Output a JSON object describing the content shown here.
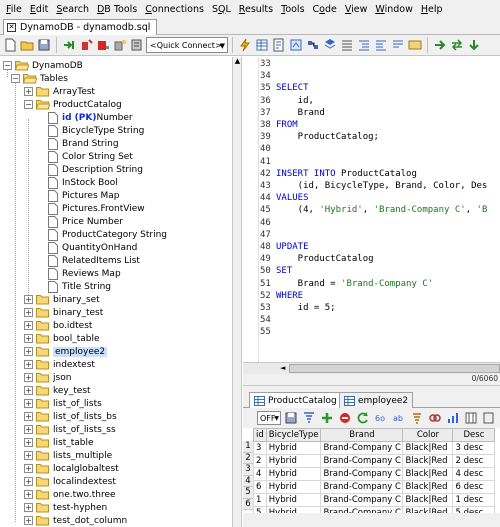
{
  "menu": [
    "File",
    "Edit",
    "Search",
    "DB Tools",
    "Connections",
    "SQL",
    "Results",
    "Tools",
    "Code",
    "View",
    "Window",
    "Help"
  ],
  "menu_mnemonic": [
    "F",
    "E",
    "S",
    "D",
    "C",
    "Q",
    "R",
    "T",
    "o",
    "V",
    "W",
    "H"
  ],
  "file_tab": {
    "title": "DynamoDB - dynamodb.sql"
  },
  "toolbar": {
    "quick_connect": "<Quick Connect>"
  },
  "tree": {
    "root": "DynamoDB",
    "tables_label": "Tables",
    "tables": [
      "ArrayTest",
      "ProductCatalog"
    ],
    "columns": [
      {
        "pk": "id (PK)",
        "rest": " Number"
      },
      {
        "pk": "",
        "rest": "BicycleType String"
      },
      {
        "pk": "",
        "rest": "Brand String"
      },
      {
        "pk": "",
        "rest": "Color String Set"
      },
      {
        "pk": "",
        "rest": "Description String"
      },
      {
        "pk": "",
        "rest": "InStock Bool"
      },
      {
        "pk": "",
        "rest": "Pictures Map"
      },
      {
        "pk": "",
        "rest": "Pictures.FrontView"
      },
      {
        "pk": "",
        "rest": "Price Number"
      },
      {
        "pk": "",
        "rest": "ProductCategory String"
      },
      {
        "pk": "",
        "rest": "QuantityOnHand"
      },
      {
        "pk": "",
        "rest": "RelatedItems List"
      },
      {
        "pk": "",
        "rest": "Reviews Map"
      },
      {
        "pk": "",
        "rest": "Title String"
      }
    ],
    "other_tables": [
      "binary_set",
      "binary_test",
      "bo.idtest",
      "bool_table",
      "employee2",
      "indextest",
      "json",
      "key_test",
      "list_of_lists",
      "list_of_lists_bs",
      "list_of_lists_ss",
      "list_table",
      "lists_multiple",
      "localglobaltest",
      "localindextest",
      "one.two.three",
      "test-hyphen",
      "test_dot_column"
    ],
    "selected_table": "employee2"
  },
  "editor": {
    "lines": [
      {
        "n": "33",
        "t": ""
      },
      {
        "n": "34",
        "t": ""
      },
      {
        "n": "35",
        "t": "SELECT",
        "k": true
      },
      {
        "n": "36",
        "t": "    id,"
      },
      {
        "n": "37",
        "t": "    Brand"
      },
      {
        "n": "38",
        "t": "FROM",
        "k": true
      },
      {
        "n": "39",
        "t": "    ProductCatalog;"
      },
      {
        "n": "40",
        "t": ""
      },
      {
        "n": "41",
        "t": ""
      },
      {
        "n": "42",
        "t": "INSERT INTO ProductCatalog",
        "k": true
      },
      {
        "n": "43",
        "t": "    (id, BicycleType, Brand, Color, Des"
      },
      {
        "n": "44",
        "t": "VALUES",
        "k": true
      },
      {
        "n": "45",
        "t": "    (4, 'Hybrid', 'Brand-Company C', 'B"
      },
      {
        "n": "46",
        "t": ""
      },
      {
        "n": "47",
        "t": ""
      },
      {
        "n": "48",
        "t": "UPDATE",
        "k": true
      },
      {
        "n": "49",
        "t": "    ProductCatalog"
      },
      {
        "n": "50",
        "t": "SET",
        "k": true
      },
      {
        "n": "51",
        "t": "    Brand = 'Brand-Company C'"
      },
      {
        "n": "52",
        "t": "WHERE",
        "k": true
      },
      {
        "n": "53",
        "t": "    id = 5;"
      },
      {
        "n": "54",
        "t": ""
      },
      {
        "n": "55",
        "t": ""
      }
    ],
    "position": "0/6060"
  },
  "results": {
    "tabs": [
      "ProductCatalog",
      "employee2"
    ],
    "offset_label": "OFF",
    "columns": [
      "id",
      "BicycleType",
      "Brand",
      "Color",
      "Desc"
    ],
    "row_numbers": [
      "1",
      "2",
      "3",
      "4",
      "5",
      "6"
    ],
    "rows": [
      [
        "3",
        "Hybrid",
        "Brand-Company C",
        "Black|Red",
        "3 desc"
      ],
      [
        "2",
        "Hybrid",
        "Brand-Company C",
        "Black|Red",
        "2 desc"
      ],
      [
        "4",
        "Hybrid",
        "Brand-Company C",
        "Black|Red",
        "4 desc"
      ],
      [
        "6",
        "Hybrid",
        "Brand-Company C",
        "Black|Red",
        "6 desc"
      ],
      [
        "1",
        "Hybrid",
        "Brand-Company C",
        "Black|Red",
        "1 desc"
      ],
      [
        "5",
        "Hybrid",
        "Brand-Company C",
        "Black|Red",
        "5 desc"
      ]
    ]
  }
}
